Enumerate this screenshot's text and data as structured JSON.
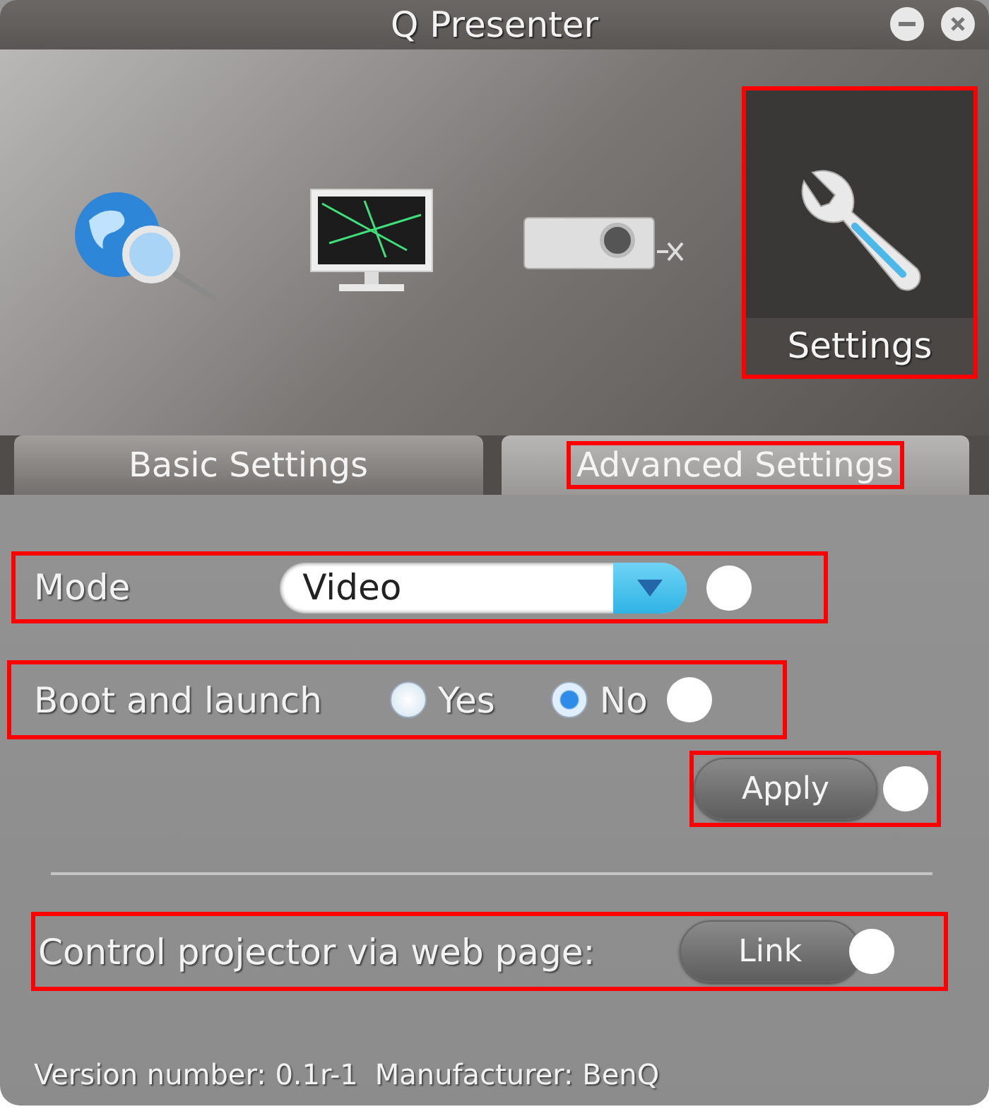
{
  "window": {
    "title": "Q Presenter"
  },
  "nav": [
    {
      "kind": "search",
      "selected": false,
      "highlighted": false
    },
    {
      "kind": "display",
      "selected": false,
      "highlighted": false
    },
    {
      "kind": "projector",
      "selected": false,
      "highlighted": false
    },
    {
      "kind": "settings",
      "label": "Settings",
      "selected": true,
      "highlighted": true
    }
  ],
  "tabs": [
    {
      "label": "Basic Settings",
      "selected": false,
      "highlighted": false
    },
    {
      "label": "Advanced Settings",
      "selected": true,
      "highlighted": true
    }
  ],
  "mode": {
    "label": "Mode",
    "value": "Video",
    "highlighted": true,
    "marker": true
  },
  "boot_and_launch": {
    "label": "Boot and launch",
    "highlighted": true,
    "marker": true,
    "options": [
      {
        "label": "Yes",
        "selected": false
      },
      {
        "label": "No",
        "selected": true
      }
    ]
  },
  "apply": {
    "label": "Apply",
    "highlighted": true,
    "marker": true
  },
  "web_control": {
    "label": "Control projector via web page:",
    "button": "Link",
    "highlighted": true,
    "marker": true
  },
  "footer": {
    "version": "Version number: 0.1r-1",
    "manufacturer": "Manufacturer: BenQ"
  }
}
